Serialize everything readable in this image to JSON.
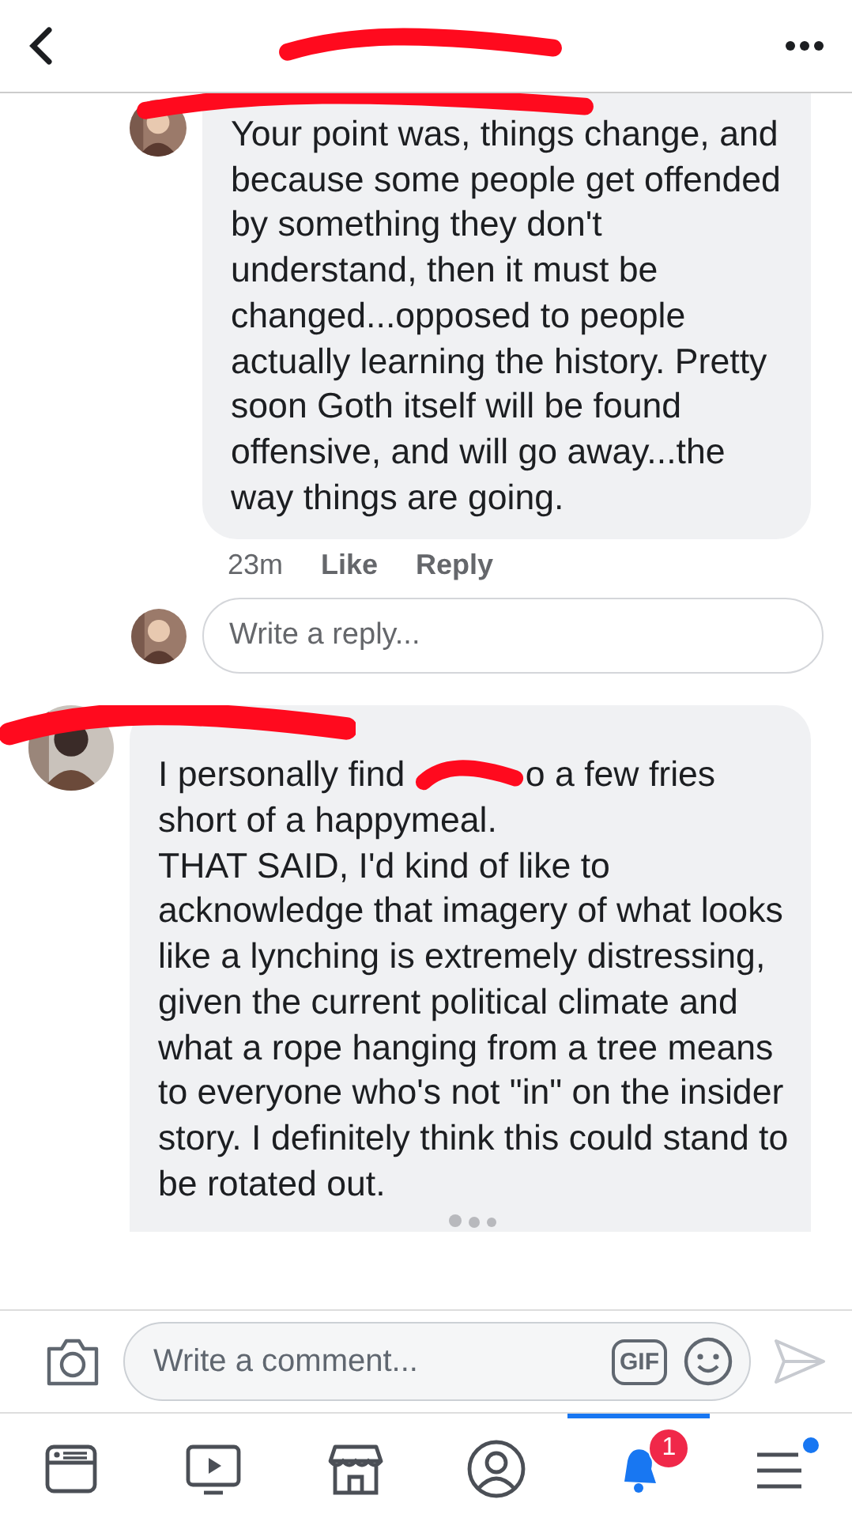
{
  "header": {
    "title_redacted": true
  },
  "comments": [
    {
      "name_redacted": true,
      "segments": [
        {
          "kind": "text",
          "text": "Your point was, things change, and because some people get offended by something they don't understand, then it must be changed...opposed to people actually learning the history. Pretty soon Goth itself will be found offensive, and will go away...the way things are going."
        }
      ],
      "time": "23m",
      "actions": [
        "Like",
        "Reply"
      ]
    },
    {
      "name_redacted": true,
      "segments": [
        {
          "kind": "text",
          "text": "I personally find "
        },
        {
          "kind": "redaction"
        },
        {
          "kind": "text",
          "text": "o a few fries short of a happymeal.\nTHAT SAID, I'd kind of like to acknowledge that imagery of what looks like a lynching is extremely distressing, given the current political climate and what a rope hanging from a tree means to everyone who's not \"in\" on the insider story. I definitely think this could stand to be rotated out."
        }
      ],
      "typing": true
    }
  ],
  "reply_box": {
    "placeholder": "Write a reply..."
  },
  "composer": {
    "placeholder": "Write a comment...",
    "gif": "GIF"
  },
  "nav": [
    {
      "kind": "feed",
      "selected": false
    },
    {
      "kind": "watch",
      "selected": false
    },
    {
      "kind": "marketplace",
      "selected": false
    },
    {
      "kind": "profile",
      "selected": false
    },
    {
      "kind": "notifications",
      "selected": true,
      "badge": "1"
    },
    {
      "kind": "menu",
      "selected": false,
      "indicator": true
    }
  ]
}
